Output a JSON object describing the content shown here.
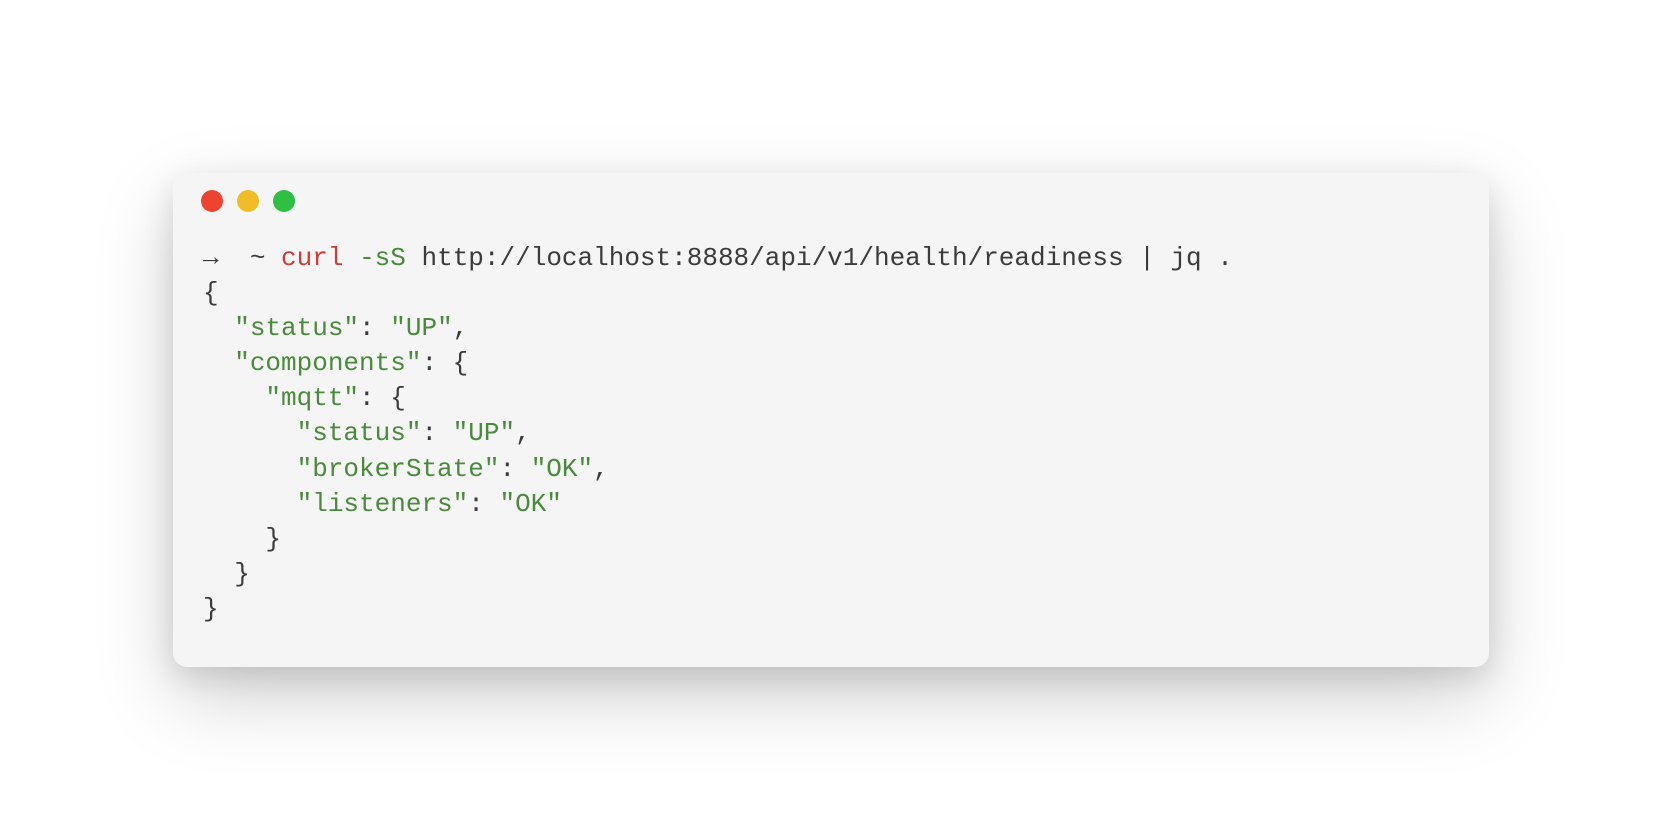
{
  "prompt": {
    "arrow": "→",
    "cwd": "~",
    "command": "curl",
    "flags": "-sS",
    "url": "http://localhost:8888/api/v1/health/readiness",
    "pipe": "|",
    "jq_cmd": "jq",
    "jq_arg": "."
  },
  "output": {
    "line1_open": "{",
    "line2_key": "\"status\"",
    "line2_colon": ": ",
    "line2_val": "\"UP\"",
    "line2_comma": ",",
    "line3_key": "\"components\"",
    "line3_colon": ": {",
    "line4_key": "\"mqtt\"",
    "line4_colon": ": {",
    "line5_key": "\"status\"",
    "line5_colon": ": ",
    "line5_val": "\"UP\"",
    "line5_comma": ",",
    "line6_key": "\"brokerState\"",
    "line6_colon": ": ",
    "line6_val": "\"OK\"",
    "line6_comma": ",",
    "line7_key": "\"listeners\"",
    "line7_colon": ": ",
    "line7_val": "\"OK\"",
    "line8_close": "}",
    "line9_close": "}",
    "line10_close": "}"
  }
}
